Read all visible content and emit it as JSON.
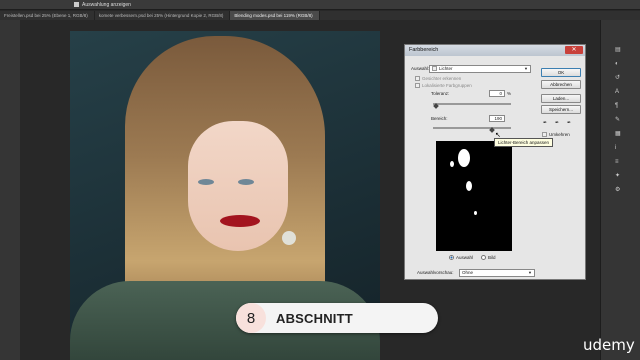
{
  "optionsbar": {
    "label": "Auswahlung anzeigen"
  },
  "tabs": [
    {
      "label": "Freistellen.psd bei 25% (Ebene 1, RGB/8)",
      "active": false
    },
    {
      "label": "komete verbessern.psd bei 25% (Hintergrund Kopie 2, RGB/8)",
      "active": false
    },
    {
      "label": "Blending modes.psd bei 119% (RGB/8)",
      "active": true
    }
  ],
  "dialog": {
    "title": "Farbbereich",
    "close_icon": "close-icon",
    "auswahl_label": "Auswahl:",
    "auswahl_value": "Lichter",
    "gesichter_label": "Gesichter erkennen",
    "lokalisierte_label": "Lokalisierte Farbgruppen",
    "toleranz_label": "Toleranz:",
    "toleranz_value": "0",
    "toleranz_unit": "%",
    "bereich_label": "Bereich:",
    "bereich_value": "190",
    "bereich_level": 0.75,
    "buttons": {
      "ok": "OK",
      "abbrechen": "Abbrechen",
      "laden": "Laden...",
      "speichern": "Speichern..."
    },
    "umkehren_label": "Umkehren",
    "radio_auswahl": "Auswahl",
    "radio_bild": "Bild",
    "vorschau_label": "Auswahlvorschau:",
    "vorschau_value": "Ohne"
  },
  "tooltip": "Lichter-Bereich anpassen",
  "section": {
    "number": "8",
    "title": "ABSCHNITT"
  },
  "watermark": "udemy",
  "panel_icons": [
    "layers-icon",
    "adjust-icon",
    "history-icon",
    "text-icon",
    "paragraph-icon",
    "brush-icon",
    "swatch-icon",
    "info-icon",
    "channel-icon",
    "path-icon",
    "settings-icon"
  ]
}
